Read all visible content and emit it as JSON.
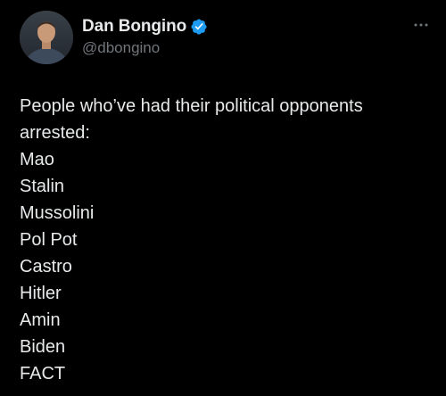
{
  "author": {
    "display_name": "Dan Bongino",
    "handle": "@dbongino",
    "verified_icon": "verified-badge-icon",
    "accent_color": "#1d9bf0"
  },
  "actions": {
    "more_icon": "more-options-icon"
  },
  "tweet": {
    "lines": [
      "People who’ve had their political opponents",
      "arrested:",
      "Mao",
      "Stalin",
      "Mussolini",
      "Pol Pot",
      "Castro",
      "Hitler",
      "Amin",
      "Biden",
      "FACT"
    ]
  }
}
